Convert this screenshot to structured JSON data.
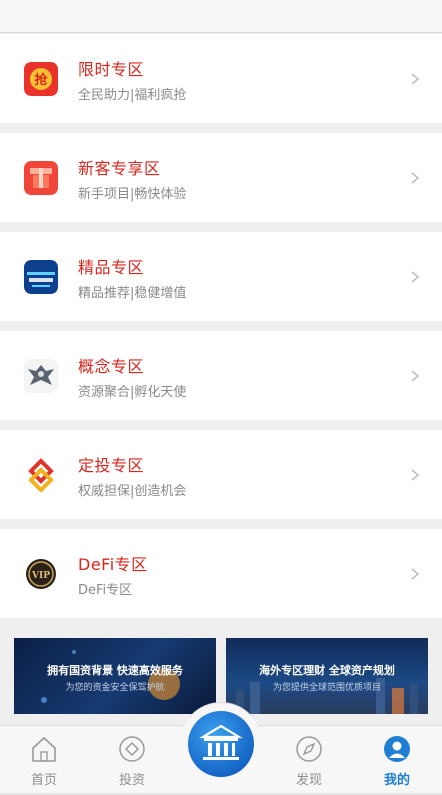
{
  "zones": [
    {
      "title": "限时专区",
      "subtitle": "全民助力|福利疯抢",
      "icon": "qiang-icon"
    },
    {
      "title": "新客专享区",
      "subtitle": "新手项目|畅快体验",
      "icon": "gift-box-icon"
    },
    {
      "title": "精品专区",
      "subtitle": "精品推荐|稳健增值",
      "icon": "premium-icon"
    },
    {
      "title": "概念专区",
      "subtitle": "资源聚合|孵化天使",
      "icon": "eagle-emblem-icon"
    },
    {
      "title": "定投专区",
      "subtitle": "权威担保|创造机会",
      "icon": "knot-logo-icon"
    },
    {
      "title": "DeFi专区",
      "subtitle": "DeFi专区",
      "icon": "vip-coin-icon"
    }
  ],
  "banners": [
    {
      "headline": "拥有国资背景 快速高效服务",
      "subline": "为您的资金安全保驾护航"
    },
    {
      "headline": "海外专区理财 全球资产规划",
      "subline": "为您提供全球范围优质项目"
    }
  ],
  "tabs": {
    "home": "首页",
    "invest": "投资",
    "discover": "发现",
    "mine": "我的"
  },
  "colors": {
    "title_red": "#d9261c",
    "active_blue": "#1e7fd3",
    "subtitle_gray": "#8a8a8a"
  }
}
